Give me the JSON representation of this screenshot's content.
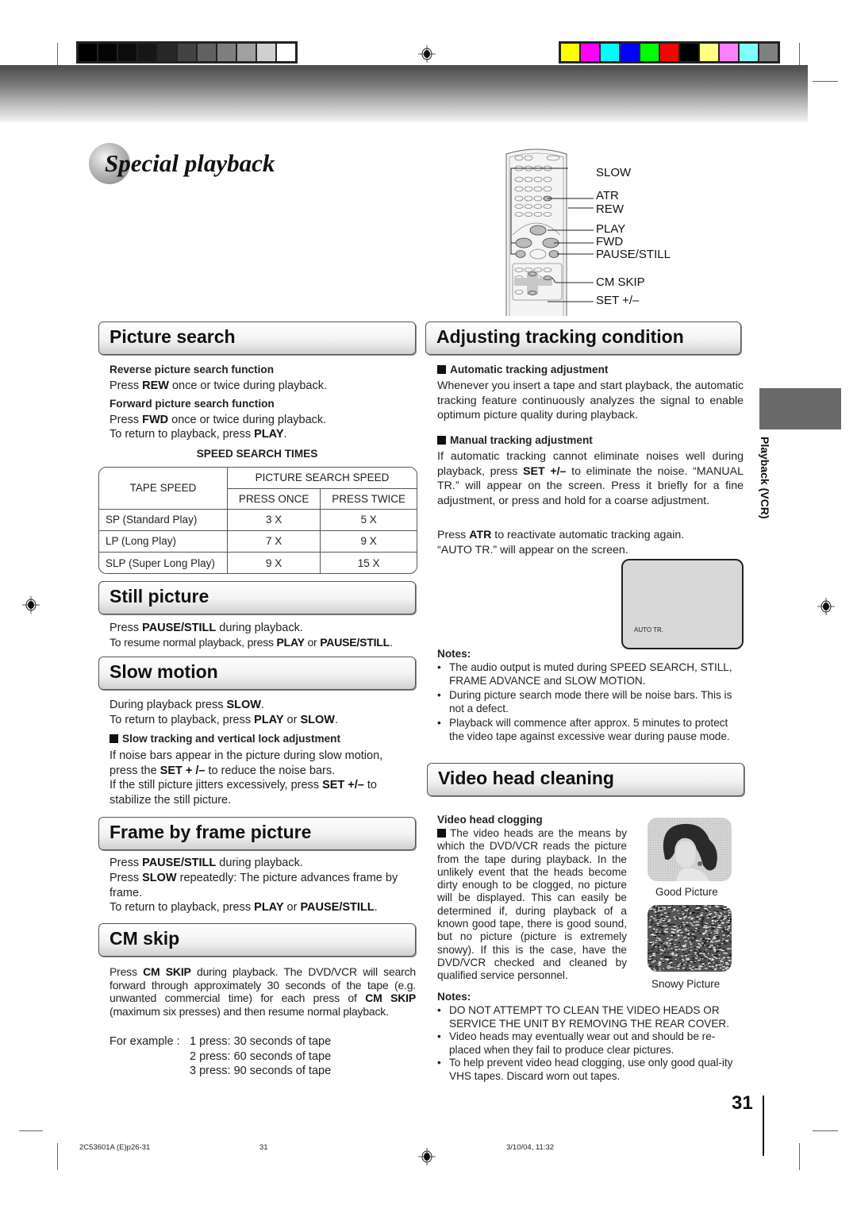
{
  "print_marks": {
    "gray_swatches": [
      "#000000",
      "#050505",
      "#0c0c0c",
      "#161616",
      "#272727",
      "#434343",
      "#616161",
      "#7f7f7f",
      "#a0a0a0",
      "#d0d0d0",
      "#ffffff"
    ],
    "color_swatches": [
      "#ffff00",
      "#ff00ff",
      "#00ffff",
      "#0000ff",
      "#00ff00",
      "#ff0000",
      "#000000",
      "#ffff80",
      "#ff80ff",
      "#80ffff",
      "#808080"
    ]
  },
  "page": {
    "title": "Special playback",
    "side_tab_label": "Playback (VCR)",
    "page_number": "31"
  },
  "remote_labels": [
    "SLOW",
    "ATR",
    "REW",
    "PLAY",
    "FWD",
    "PAUSE/STILL",
    "CM SKIP",
    "SET +/–"
  ],
  "picture_search": {
    "heading": "Picture search",
    "reverse_title": "Reverse picture search function",
    "reverse_pre": "Press ",
    "reverse_key": "REW",
    "reverse_post": " once or twice during playback.",
    "forward_title": "Forward picture search function",
    "forward_pre": "Press ",
    "forward_key": "FWD",
    "forward_post": " once or twice during playback.",
    "return_pre": "To return to playback, press ",
    "return_key": "PLAY",
    "return_post": ".",
    "table_title": "SPEED SEARCH TIMES",
    "table": {
      "col_tape_speed": "TAPE SPEED",
      "col_group": "PICTURE SEARCH SPEED",
      "col_once": "PRESS ONCE",
      "col_twice": "PRESS TWICE",
      "rows": [
        {
          "speed": "SP (Standard Play)",
          "once": "3 X",
          "twice": "5 X"
        },
        {
          "speed": "LP (Long Play)",
          "once": "7 X",
          "twice": "9 X"
        },
        {
          "speed": "SLP (Super Long Play)",
          "once": "9 X",
          "twice": "15 X"
        }
      ]
    }
  },
  "still_picture": {
    "heading": "Still picture",
    "l1_pre": "Press ",
    "l1_key": "PAUSE/STILL",
    "l1_post": " during playback.",
    "l2_pre": "To resume normal playback, press ",
    "l2_key1": "PLAY",
    "l2_mid": " or ",
    "l2_key2": "PAUSE/STILL",
    "l2_post": "."
  },
  "slow_motion": {
    "heading": "Slow motion",
    "l1_pre": "During playback press ",
    "l1_key": "SLOW",
    "l1_post": ".",
    "l2_pre": "To return to playback, press ",
    "l2_key1": "PLAY",
    "l2_mid": " or ",
    "l2_key2": "SLOW",
    "l2_post": ".",
    "sub_title": "Slow tracking and vertical lock adjustment",
    "p1_pre": "If noise bars appear in the picture during slow motion, press the ",
    "p1_key": "SET + /–",
    "p1_post": " to reduce the noise bars.",
    "p2_pre": "If the still picture jitters excessively, press ",
    "p2_key": "SET +/–",
    "p2_post": " to stabilize the still picture."
  },
  "frame_by_frame": {
    "heading": "Frame by frame picture",
    "l1_pre": "Press ",
    "l1_key": "PAUSE/STILL",
    "l1_post": " during playback.",
    "l2_pre": "Press ",
    "l2_key": "SLOW",
    "l2_post": " repeatedly: The picture advances frame by frame.",
    "l3_pre": "To return to playback, press ",
    "l3_key1": "PLAY",
    "l3_mid": " or ",
    "l3_key2": "PAUSE/STILL",
    "l3_post": "."
  },
  "cm_skip": {
    "heading": "CM skip",
    "p_pre": "Press ",
    "p_key1": "CM SKIP",
    "p_mid": " during playback. The DVD/VCR will search forward through approximately 30 seconds of the tape (e.g. unwanted commercial time) for each press of ",
    "p_key2": "CM SKIP",
    "p_post": " (maximum six presses) and then resume normal playback.",
    "example_label": "For example :",
    "examples": [
      "1 press: 30 seconds of tape",
      "2 press: 60 seconds of tape",
      "3 press: 90 seconds of tape"
    ]
  },
  "tracking": {
    "heading": "Adjusting tracking condition",
    "auto_title": "Automatic tracking adjustment",
    "auto_text": "Whenever you insert a tape and start playback, the automatic tracking feature continuously analyzes the signal to enable optimum picture quality during playback.",
    "manual_title": "Manual tracking adjustment",
    "manual_pre": "If automatic tracking cannot eliminate noises well during playback, press ",
    "manual_key": "SET +/–",
    "manual_post": " to eliminate the noise. “MANUAL TR.” will appear on the screen. Press it briefly for a fine adjustment, or press and hold for a coarse adjustment.",
    "atr_pre": "Press ",
    "atr_key": "ATR",
    "atr_post": " to reactivate automatic tracking again.",
    "atr_line2": "“AUTO TR.” will appear on the screen.",
    "screen_osd": "AUTO TR.",
    "notes_title": "Notes:",
    "notes": [
      "The audio output is muted during SPEED SEARCH, STILL, FRAME ADVANCE and SLOW MOTION.",
      "During picture search mode there will be noise bars. This is not a defect.",
      "Playback will commence after approx. 5 minutes to protect the video tape against excessive wear during pause mode."
    ]
  },
  "video_head": {
    "heading": "Video head cleaning",
    "sub_title": "Video head clogging",
    "text": "The video heads are the means by which the DVD/VCR reads the picture from the tape during playback. In the unlikely event that the heads become dirty enough to be clogged, no picture will be displayed. This can easily be determined if, during playback of a known good tape, there is good sound, but no picture (picture is extremely snowy). If this is the case, have the DVD/VCR checked and cleaned by qualified service personnel.",
    "good_caption": "Good Picture",
    "snowy_caption": "Snowy Picture",
    "notes_title": "Notes:",
    "notes": [
      "DO NOT ATTEMPT TO CLEAN THE VIDEO HEADS OR SERVICE THE UNIT BY REMOVING THE REAR COVER.",
      "Video heads may eventually wear out and should be re-placed when they fail to produce clear pictures.",
      "To help prevent video head clogging, use only good qual-ity VHS tapes. Discard worn out tapes."
    ]
  },
  "footer": {
    "file": "2C53601A (E)p26-31",
    "page": "31",
    "date": "3/10/04, 11:32"
  }
}
